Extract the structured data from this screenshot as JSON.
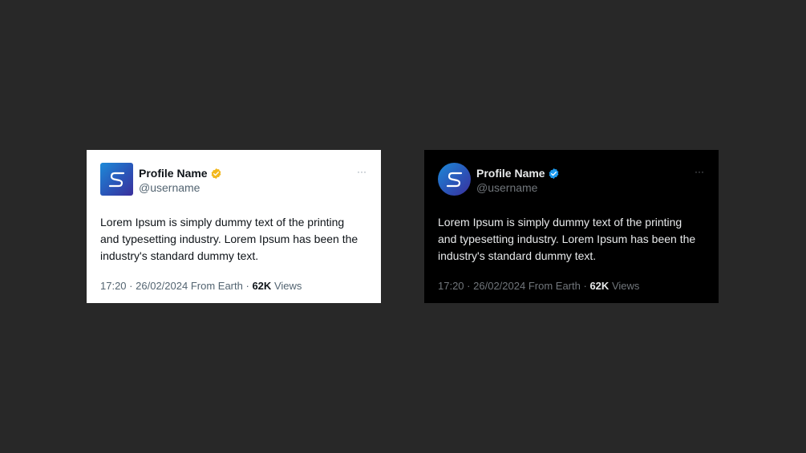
{
  "light_post": {
    "profile_name": "Profile Name",
    "username": "@username",
    "badge_color": "#f2b81d",
    "more_label": "···",
    "text": "Lorem Ipsum is simply dummy text of the printing and typesetting industry. Lorem Ipsum has been the industry's standard dummy text.",
    "time": "17:20",
    "separator": "·",
    "date": "26/02/2024",
    "location": "From Earth",
    "views_count": "62K",
    "views_label": "Views"
  },
  "dark_post": {
    "profile_name": "Profile Name",
    "username": "@username",
    "badge_color": "#1d9bf0",
    "more_label": "···",
    "text": "Lorem Ipsum is simply dummy text of the printing and typesetting industry. Lorem Ipsum has been the industry's standard dummy text.",
    "time": "17:20",
    "separator": "·",
    "date": "26/02/2024",
    "location": "From Earth",
    "views_count": "62K",
    "views_label": "Views"
  },
  "icons": {
    "avatar": "s-logo-icon",
    "badge": "verified-badge-icon",
    "more": "more-options-icon"
  }
}
